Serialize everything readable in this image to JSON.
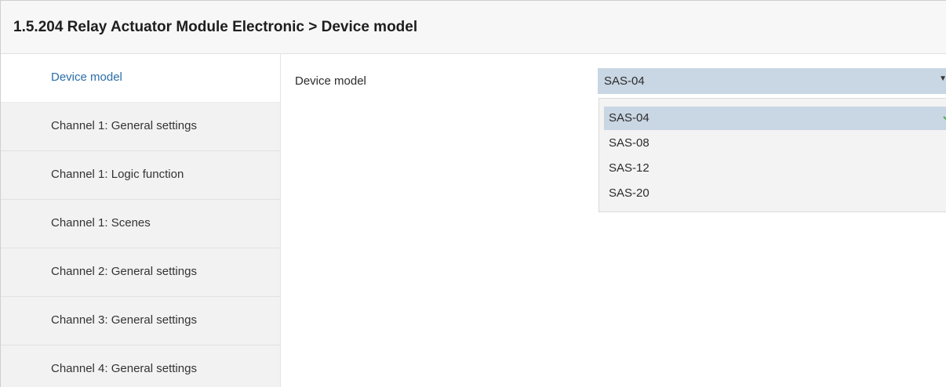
{
  "header": {
    "title": "1.5.204 Relay Actuator Module Electronic > Device model"
  },
  "sidebar": {
    "items": [
      {
        "label": "Device model"
      },
      {
        "label": "Channel 1: General settings"
      },
      {
        "label": "Channel 1: Logic function"
      },
      {
        "label": "Channel 1: Scenes"
      },
      {
        "label": "Channel 2: General settings"
      },
      {
        "label": "Channel 3: General settings"
      },
      {
        "label": "Channel 4: General settings"
      }
    ],
    "active_index": 0
  },
  "main": {
    "field_label": "Device model",
    "select": {
      "value": "SAS-04",
      "icon": "chevron-down-icon"
    },
    "dropdown": {
      "options": [
        {
          "label": "SAS-04"
        },
        {
          "label": "SAS-08"
        },
        {
          "label": "SAS-12"
        },
        {
          "label": "SAS-20"
        }
      ],
      "selected_index": 0,
      "selected_icon": "check-icon"
    }
  },
  "colors": {
    "accent_link": "#2a6ea8",
    "selection": "#c9d6e3",
    "check": "#4caf50"
  }
}
